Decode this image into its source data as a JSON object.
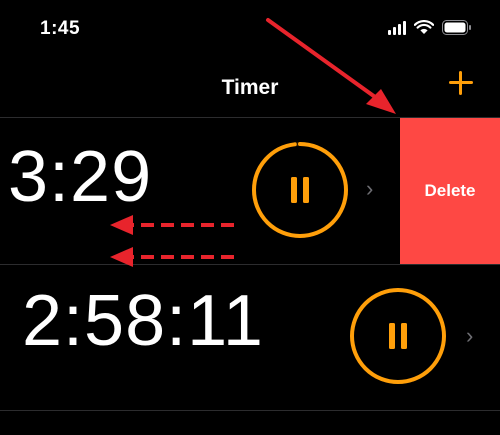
{
  "status_bar": {
    "time": "1:45"
  },
  "nav": {
    "title": "Timer"
  },
  "timers": [
    {
      "time": "3:29",
      "delete_label": "Delete",
      "progress": 0.98
    },
    {
      "time": "2:58:11"
    }
  ],
  "colors": {
    "accent": "#ff9f0a",
    "delete": "#fe4844",
    "annotation": "#e8242c",
    "background": "#000000",
    "separator": "#2c2c2e"
  }
}
